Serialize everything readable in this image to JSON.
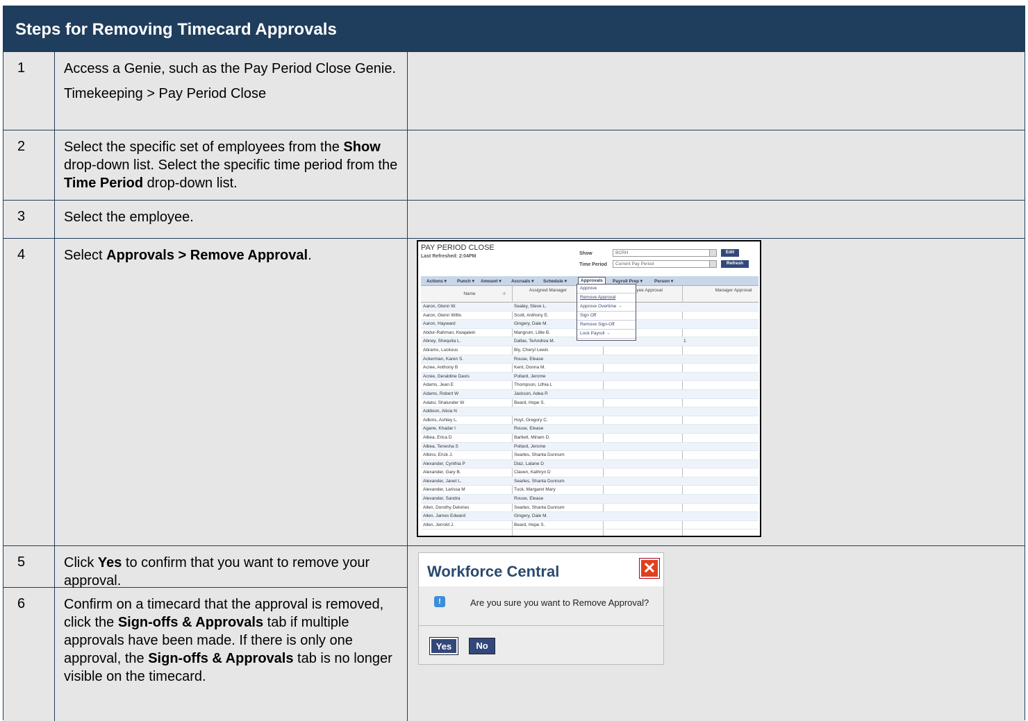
{
  "title": "Steps for Removing Timecard Approvals",
  "steps": [
    {
      "num": "1",
      "lines": [
        "Access a Genie, such as the Pay Period Close Genie.",
        "Timekeeping > Pay Period Close"
      ]
    },
    {
      "num": "2",
      "parts": [
        {
          "t": "Select the specific set of employees from the "
        },
        {
          "t": "Show",
          "b": true
        },
        {
          "t": " drop-down list. Select the specific time period from the "
        },
        {
          "t": "Time Period",
          "b": true
        },
        {
          "t": " drop-down list."
        }
      ]
    },
    {
      "num": "3",
      "parts": [
        {
          "t": "Select the employee."
        }
      ]
    },
    {
      "num": "4",
      "parts": [
        {
          "t": "Select "
        },
        {
          "t": "Approvals > Remove Approval",
          "b": true
        },
        {
          "t": "."
        }
      ]
    },
    {
      "num": "5",
      "parts": [
        {
          "t": "Click "
        },
        {
          "t": "Yes",
          "b": true
        },
        {
          "t": " to confirm that you want to remove your approval."
        }
      ]
    },
    {
      "num": "6",
      "parts": [
        {
          "t": "Confirm on a timecard that the approval is removed, click the "
        },
        {
          "t": "Sign-offs & Approvals",
          "b": true
        },
        {
          "t": " tab if multiple approvals have been made.  If there is only one approval, the "
        },
        {
          "t": "Sign-offs & Approvals",
          "b": true
        },
        {
          "t": " tab is no longer visible on the timecard."
        }
      ]
    }
  ],
  "ppc": {
    "title": "PAY PERIOD CLOSE",
    "last_refreshed": "Last Refreshed: 2:04PM",
    "show_label": "Show",
    "show_value": "BCRH",
    "time_label": "Time Period",
    "time_value": "Current Pay Period",
    "edit": "Edit",
    "refresh": "Refresh",
    "menus": [
      "Actions ▾",
      "Punch ▾",
      "Amount ▾",
      "Accruals ▾",
      "Schedule ▾",
      "Approvals",
      "Payroll Prep ▾",
      "Person ▾"
    ],
    "headers": {
      "name": "Name",
      "sort": "↑/",
      "assigned": "Assigned Manager",
      "employee": "Employee Approval",
      "manager": "Manager Approval"
    },
    "dropdown": [
      "Approve",
      "Remove Approval",
      "Approve Overtime →",
      "Sign Off",
      "Remove Sign-Off",
      "Lock Payroll →"
    ],
    "rows": [
      [
        "Aaron, Glenn W.",
        "Sealey, Steve L.",
        ""
      ],
      [
        "Aaron, Glenn Willis",
        "Scott, Anthony E.",
        ""
      ],
      [
        "Aaron, Hayward",
        "Gingery, Dale M.",
        ""
      ],
      [
        "Abdur-Rahman, Kwajalein",
        "Mangrum, Lillie B.",
        ""
      ],
      [
        "Abney, Shequita L.",
        "Dallas, TeAndrea M.",
        "1"
      ],
      [
        "Abrams, Luckous",
        "Bly, Cheryl Lewis",
        ""
      ],
      [
        "Ackerman, Karen S.",
        "Rouse, Elease",
        ""
      ],
      [
        "Acree, Anthony B",
        "Kent, Donna M.",
        ""
      ],
      [
        "Acree, Geraldine Davis",
        "Pollard, Jerome",
        ""
      ],
      [
        "Adams, Jean E",
        "Thompson, Lithia L",
        ""
      ],
      [
        "Adams, Robert W",
        "Jackson, Adea P.",
        ""
      ],
      [
        "Adatsi, Shalunder W",
        "Beard, Hope S.",
        ""
      ],
      [
        "Addison, Alicia N",
        "",
        ""
      ],
      [
        "Adkins, Ashley L.",
        "Hoyt, Gregory C.",
        ""
      ],
      [
        "Agane, Khadar I",
        "Rouse, Elease",
        ""
      ],
      [
        "Albea, Erica D",
        "Bartlett, Miriam D.",
        ""
      ],
      [
        "Albea, Tenesha S",
        "Pollard, Jerome",
        ""
      ],
      [
        "Albino, Erick J.",
        "Searles, Shanta Dunnum",
        ""
      ],
      [
        "Alexander, Cynthia P",
        "Diaz, Latane D",
        ""
      ],
      [
        "Alexander, Gary B.",
        "Claven, Kathryn D",
        ""
      ],
      [
        "Alexander, Janet L.",
        "Searles, Shanta Dunnum",
        ""
      ],
      [
        "Alexander, Larissa M",
        "Tuck, Margaret Mary",
        ""
      ],
      [
        "Alexander, Sandra",
        "Rouse, Elease",
        ""
      ],
      [
        "Allen, Dorothy Delories",
        "Searles, Shanta Dunnum",
        ""
      ],
      [
        "Allen, James Edward",
        "Gingery, Dale M.",
        ""
      ],
      [
        "Allen, Jerrold J.",
        "Beard, Hope S.",
        ""
      ]
    ]
  },
  "dialog": {
    "title": "Workforce Central",
    "close": "✕",
    "info_icon": "!",
    "message": "Are you sure you want to Remove Approval?",
    "yes": "Yes",
    "no": "No"
  }
}
